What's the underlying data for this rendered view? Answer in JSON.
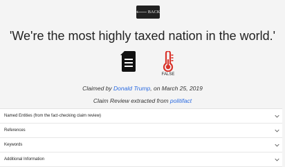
{
  "back_button": {
    "label": "BACK",
    "icon": "arrow-left-icon"
  },
  "claim": {
    "quote": "'We're the most highly taxed nation in the world.'",
    "verdict": "FALSE",
    "claimed_prefix": "Claimed by ",
    "claimant": "Donald Trump",
    "claimed_suffix": ", on March 25, 2019",
    "review_prefix": "Claim Review extracted from ",
    "review_source": "politifact"
  },
  "accordion": [
    {
      "label": "Named Entities (from the fact-checking claim review)"
    },
    {
      "label": "References"
    },
    {
      "label": "Keywords"
    },
    {
      "label": "Additional Information"
    }
  ],
  "colors": {
    "false_verdict": "#d9342b",
    "link": "#2a6ae0",
    "button_bg": "#212121"
  }
}
